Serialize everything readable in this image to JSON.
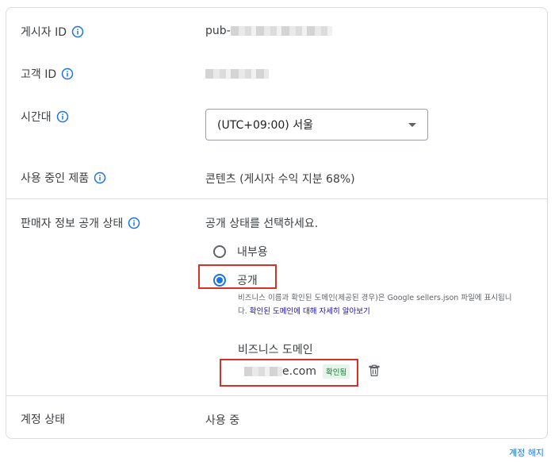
{
  "publisher": {
    "label": "게시자 ID",
    "value_prefix": "pub-"
  },
  "customer": {
    "label": "고객 ID"
  },
  "timezone": {
    "label": "시간대",
    "selected": "(UTC+09:00) 서울"
  },
  "product": {
    "label": "사용 중인 제품",
    "value": "콘텐츠 (게시자 수익 지분 68%)"
  },
  "seller_info": {
    "label": "판매자 정보 공개 상태",
    "prompt": "공개 상태를 선택하세요.",
    "options": [
      {
        "label": "내부용",
        "selected": false
      },
      {
        "label": "공개",
        "selected": true
      }
    ],
    "helper_text": "비즈니스 이름과 확인된 도메인(제공된 경우)은 Google sellers.json 파일에 표시됩니다.",
    "helper_link": "확인된 도메인에 대해 자세히 알아보기",
    "domain_title": "비즈니스 도메인",
    "domain_suffix": "e.com",
    "verified_badge": "확인됨"
  },
  "account": {
    "label": "계정 상태",
    "value": "사용 중"
  },
  "footer": {
    "close_account": "계정 해지"
  },
  "colors": {
    "accent": "#1a73e8",
    "highlight": "#d93025",
    "verified": "#137333"
  }
}
